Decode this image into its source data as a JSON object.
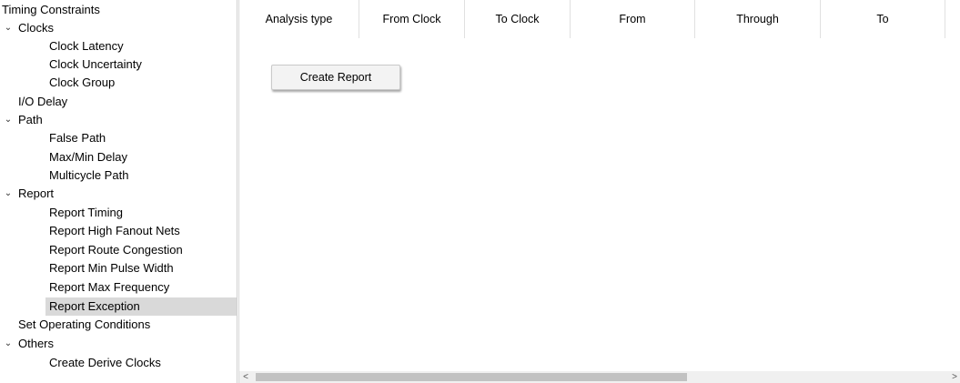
{
  "tree": {
    "root_label": "Timing Constraints",
    "items": [
      {
        "label": "Clocks",
        "expanded": true
      },
      {
        "label": "Clock Latency"
      },
      {
        "label": "Clock Uncertainty"
      },
      {
        "label": "Clock Group"
      },
      {
        "label": "I/O Delay"
      },
      {
        "label": "Path",
        "expanded": true
      },
      {
        "label": "False Path"
      },
      {
        "label": "Max/Min Delay"
      },
      {
        "label": "Multicycle Path"
      },
      {
        "label": "Report",
        "expanded": true
      },
      {
        "label": "Report Timing"
      },
      {
        "label": "Report High Fanout Nets"
      },
      {
        "label": "Report Route Congestion"
      },
      {
        "label": "Report Min Pulse Width"
      },
      {
        "label": "Report Max Frequency"
      },
      {
        "label": "Report Exception",
        "selected": true
      },
      {
        "label": "Set Operating Conditions"
      },
      {
        "label": "Others",
        "expanded": true
      },
      {
        "label": "Create Derive Clocks"
      }
    ]
  },
  "table": {
    "columns": [
      "Analysis type",
      "From Clock",
      "To Clock",
      "From",
      "Through",
      "To"
    ]
  },
  "actions": {
    "create_report_label": "Create Report"
  },
  "scrollbar": {
    "left_arrow": "<",
    "right_arrow": ">"
  },
  "colors": {
    "selected_row": "#d9d9d9",
    "button_bg": "#f3f3f3",
    "scroll_thumb": "#c2c2c2"
  }
}
